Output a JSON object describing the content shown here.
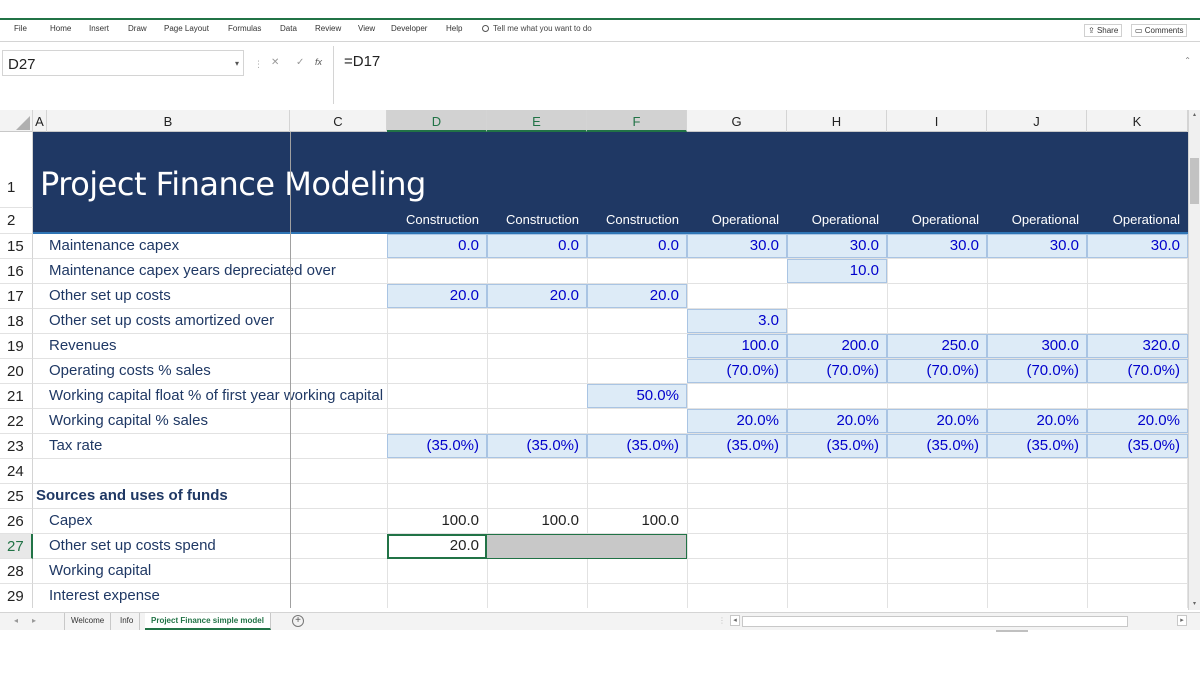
{
  "ribbon": {
    "tabs": [
      "File",
      "Home",
      "Insert",
      "Draw",
      "Page Layout",
      "Formulas",
      "Data",
      "Review",
      "View",
      "Developer",
      "Help"
    ],
    "tell_me": "Tell me what you want to do",
    "share": "Share",
    "comments": "Comments"
  },
  "formula_bar": {
    "name_box": "D27",
    "formula": "=D17"
  },
  "columns": [
    "A",
    "B",
    "C",
    "D",
    "E",
    "F",
    "G",
    "H",
    "I",
    "J",
    "K"
  ],
  "selected_columns": [
    "D",
    "E",
    "F"
  ],
  "title": "Project Finance Modeling",
  "phases": [
    "Construction",
    "Construction",
    "Construction",
    "Operational",
    "Operational",
    "Operational",
    "Operational",
    "Operational"
  ],
  "rows": [
    {
      "num": "1"
    },
    {
      "num": "2"
    },
    {
      "num": "15",
      "label": "Maintenance capex",
      "D": "0.0",
      "E": "0.0",
      "F": "0.0",
      "G": "30.0",
      "H": "30.0",
      "I": "30.0",
      "J": "30.0",
      "K": "30.0"
    },
    {
      "num": "16",
      "label": "Maintenance capex years depreciated over",
      "H": "10.0"
    },
    {
      "num": "17",
      "label": "Other set up costs",
      "D": "20.0",
      "E": "20.0",
      "F": "20.0"
    },
    {
      "num": "18",
      "label": "Other set up costs amortized over",
      "G": "3.0"
    },
    {
      "num": "19",
      "label": "Revenues",
      "G": "100.0",
      "H": "200.0",
      "I": "250.0",
      "J": "300.0",
      "K": "320.0"
    },
    {
      "num": "20",
      "label": "Operating costs % sales",
      "G": "(70.0%)",
      "H": "(70.0%)",
      "I": "(70.0%)",
      "J": "(70.0%)",
      "K": "(70.0%)"
    },
    {
      "num": "21",
      "label": "Working capital float % of first year working capital",
      "F": "50.0%"
    },
    {
      "num": "22",
      "label": "Working capital % sales",
      "G": "20.0%",
      "H": "20.0%",
      "I": "20.0%",
      "J": "20.0%",
      "K": "20.0%"
    },
    {
      "num": "23",
      "label": "Tax rate",
      "D": "(35.0%)",
      "E": "(35.0%)",
      "F": "(35.0%)",
      "G": "(35.0%)",
      "H": "(35.0%)",
      "I": "(35.0%)",
      "J": "(35.0%)",
      "K": "(35.0%)"
    },
    {
      "num": "24"
    },
    {
      "num": "25",
      "label": "Sources and uses of funds"
    },
    {
      "num": "26",
      "label": "Capex",
      "D": "100.0",
      "E": "100.0",
      "F": "100.0"
    },
    {
      "num": "27",
      "label": "Other set up costs spend",
      "D": "20.0"
    },
    {
      "num": "28",
      "label": "Working capital"
    },
    {
      "num": "29",
      "label": "Interest expense"
    }
  ],
  "sheets": [
    "Welcome",
    "Info",
    "Project Finance simple model"
  ],
  "active_sheet": "Project Finance simple model",
  "colors": {
    "excel_green": "#217346",
    "banner": "#1f3864",
    "input_fill": "#ddebf7",
    "input_value": "#0000cc"
  },
  "icons": [
    "search-icon",
    "share-icon",
    "comment-icon",
    "dropdown-icon",
    "cancel-icon",
    "enter-icon",
    "function-icon",
    "add-sheet-icon"
  ]
}
